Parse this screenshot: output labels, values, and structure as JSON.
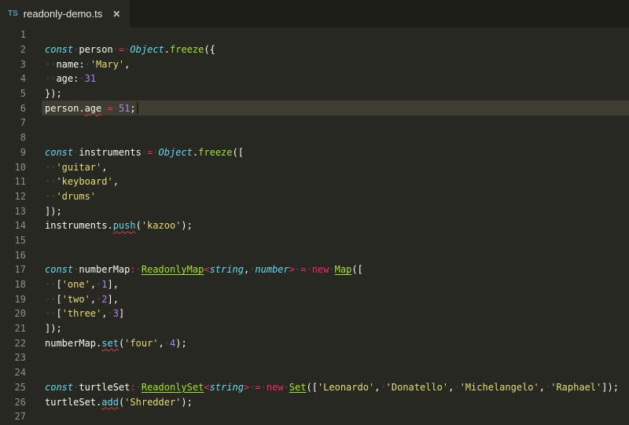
{
  "palette": {
    "background": "#272822",
    "tabbar_background": "#1d1e18",
    "line_highlight": "#3e3d32",
    "foreground": "#f8f8f2",
    "keyword": "#66d9ef",
    "operator": "#f92672",
    "function": "#a6e22e",
    "type": "#a6e22e",
    "string": "#e6db74",
    "number": "#ae81ff",
    "method": "#66d9ef",
    "line_number": "#90908a",
    "error_underline": "#e33a3a",
    "whitespace_dot": "#4f5046",
    "ts_icon": "#519aba",
    "caret": "#1e1f18"
  },
  "tab": {
    "icon_label": "TS",
    "title": "readonly-demo.ts",
    "close_label": "✕"
  },
  "editor": {
    "current_line": 6,
    "lines": [
      {
        "n": 1,
        "tokens": []
      },
      {
        "n": 2,
        "tokens": [
          {
            "c": "keyword",
            "t": "const"
          },
          {
            "c": "plain",
            "t": " person "
          },
          {
            "c": "operator",
            "t": "="
          },
          {
            "c": "plain",
            "t": " "
          },
          {
            "c": "keyword",
            "t": "Object"
          },
          {
            "c": "plain",
            "t": "."
          },
          {
            "c": "function",
            "t": "freeze"
          },
          {
            "c": "plain",
            "t": "({"
          }
        ]
      },
      {
        "n": 3,
        "tokens": [
          {
            "c": "plain",
            "t": "  name: "
          },
          {
            "c": "string",
            "t": "'Mary'"
          },
          {
            "c": "plain",
            "t": ","
          }
        ]
      },
      {
        "n": 4,
        "tokens": [
          {
            "c": "plain",
            "t": "  age: "
          },
          {
            "c": "number",
            "t": "31"
          }
        ]
      },
      {
        "n": 5,
        "tokens": [
          {
            "c": "plain",
            "t": "});"
          }
        ]
      },
      {
        "n": 6,
        "tokens": [
          {
            "c": "plain",
            "t": "person."
          },
          {
            "c": "plain",
            "t": "age",
            "e": true
          },
          {
            "c": "plain",
            "t": " "
          },
          {
            "c": "operator",
            "t": "="
          },
          {
            "c": "plain",
            "t": " "
          },
          {
            "c": "number",
            "t": "51"
          },
          {
            "c": "plain",
            "t": ";"
          }
        ]
      },
      {
        "n": 7,
        "tokens": []
      },
      {
        "n": 8,
        "tokens": []
      },
      {
        "n": 9,
        "tokens": [
          {
            "c": "keyword",
            "t": "const"
          },
          {
            "c": "plain",
            "t": " instruments "
          },
          {
            "c": "operator",
            "t": "="
          },
          {
            "c": "plain",
            "t": " "
          },
          {
            "c": "keyword",
            "t": "Object"
          },
          {
            "c": "plain",
            "t": "."
          },
          {
            "c": "function",
            "t": "freeze"
          },
          {
            "c": "plain",
            "t": "(["
          }
        ]
      },
      {
        "n": 10,
        "tokens": [
          {
            "c": "plain",
            "t": "  "
          },
          {
            "c": "string",
            "t": "'guitar'"
          },
          {
            "c": "plain",
            "t": ","
          }
        ]
      },
      {
        "n": 11,
        "tokens": [
          {
            "c": "plain",
            "t": "  "
          },
          {
            "c": "string",
            "t": "'keyboard'"
          },
          {
            "c": "plain",
            "t": ","
          }
        ]
      },
      {
        "n": 12,
        "tokens": [
          {
            "c": "plain",
            "t": "  "
          },
          {
            "c": "string",
            "t": "'drums'"
          }
        ]
      },
      {
        "n": 13,
        "tokens": [
          {
            "c": "plain",
            "t": "]);"
          }
        ]
      },
      {
        "n": 14,
        "tokens": [
          {
            "c": "plain",
            "t": "instruments."
          },
          {
            "c": "method",
            "t": "push",
            "e": true
          },
          {
            "c": "plain",
            "t": "("
          },
          {
            "c": "string",
            "t": "'kazoo'"
          },
          {
            "c": "plain",
            "t": ");"
          }
        ]
      },
      {
        "n": 15,
        "tokens": []
      },
      {
        "n": 16,
        "tokens": []
      },
      {
        "n": 17,
        "tokens": [
          {
            "c": "keyword",
            "t": "const"
          },
          {
            "c": "plain",
            "t": " numberMap"
          },
          {
            "c": "operator",
            "t": ":"
          },
          {
            "c": "plain",
            "t": " "
          },
          {
            "c": "type",
            "t": "ReadonlyMap"
          },
          {
            "c": "operator",
            "t": "<"
          },
          {
            "c": "keyword",
            "t": "string"
          },
          {
            "c": "plain",
            "t": ", "
          },
          {
            "c": "keyword",
            "t": "number"
          },
          {
            "c": "operator",
            "t": ">"
          },
          {
            "c": "plain",
            "t": " "
          },
          {
            "c": "operator",
            "t": "="
          },
          {
            "c": "plain",
            "t": " "
          },
          {
            "c": "operator",
            "t": "new"
          },
          {
            "c": "plain",
            "t": " "
          },
          {
            "c": "type",
            "t": "Map"
          },
          {
            "c": "plain",
            "t": "(["
          }
        ]
      },
      {
        "n": 18,
        "tokens": [
          {
            "c": "plain",
            "t": "  ["
          },
          {
            "c": "string",
            "t": "'one'"
          },
          {
            "c": "plain",
            "t": ", "
          },
          {
            "c": "number",
            "t": "1"
          },
          {
            "c": "plain",
            "t": "],"
          }
        ]
      },
      {
        "n": 19,
        "tokens": [
          {
            "c": "plain",
            "t": "  ["
          },
          {
            "c": "string",
            "t": "'two'"
          },
          {
            "c": "plain",
            "t": ", "
          },
          {
            "c": "number",
            "t": "2"
          },
          {
            "c": "plain",
            "t": "],"
          }
        ]
      },
      {
        "n": 20,
        "tokens": [
          {
            "c": "plain",
            "t": "  ["
          },
          {
            "c": "string",
            "t": "'three'"
          },
          {
            "c": "plain",
            "t": ", "
          },
          {
            "c": "number",
            "t": "3"
          },
          {
            "c": "plain",
            "t": "]"
          }
        ]
      },
      {
        "n": 21,
        "tokens": [
          {
            "c": "plain",
            "t": "]);"
          }
        ]
      },
      {
        "n": 22,
        "tokens": [
          {
            "c": "plain",
            "t": "numberMap."
          },
          {
            "c": "method",
            "t": "set",
            "e": true
          },
          {
            "c": "plain",
            "t": "("
          },
          {
            "c": "string",
            "t": "'four'"
          },
          {
            "c": "plain",
            "t": ", "
          },
          {
            "c": "number",
            "t": "4"
          },
          {
            "c": "plain",
            "t": ");"
          }
        ]
      },
      {
        "n": 23,
        "tokens": []
      },
      {
        "n": 24,
        "tokens": []
      },
      {
        "n": 25,
        "tokens": [
          {
            "c": "keyword",
            "t": "const"
          },
          {
            "c": "plain",
            "t": " turtleSet"
          },
          {
            "c": "operator",
            "t": ":"
          },
          {
            "c": "plain",
            "t": " "
          },
          {
            "c": "type",
            "t": "ReadonlySet"
          },
          {
            "c": "operator",
            "t": "<"
          },
          {
            "c": "keyword",
            "t": "string"
          },
          {
            "c": "operator",
            "t": ">"
          },
          {
            "c": "plain",
            "t": " "
          },
          {
            "c": "operator",
            "t": "="
          },
          {
            "c": "plain",
            "t": " "
          },
          {
            "c": "operator",
            "t": "new"
          },
          {
            "c": "plain",
            "t": " "
          },
          {
            "c": "type",
            "t": "Set"
          },
          {
            "c": "plain",
            "t": "(["
          },
          {
            "c": "string",
            "t": "'Leonardo'"
          },
          {
            "c": "plain",
            "t": ", "
          },
          {
            "c": "string",
            "t": "'Donatello'"
          },
          {
            "c": "plain",
            "t": ", "
          },
          {
            "c": "string",
            "t": "'Michelangelo'"
          },
          {
            "c": "plain",
            "t": ", "
          },
          {
            "c": "string",
            "t": "'Raphael'"
          },
          {
            "c": "plain",
            "t": "]);"
          }
        ]
      },
      {
        "n": 26,
        "tokens": [
          {
            "c": "plain",
            "t": "turtleSet."
          },
          {
            "c": "method",
            "t": "add",
            "e": true
          },
          {
            "c": "plain",
            "t": "("
          },
          {
            "c": "string",
            "t": "'Shredder'"
          },
          {
            "c": "plain",
            "t": ");"
          }
        ]
      },
      {
        "n": 27,
        "tokens": []
      }
    ]
  }
}
